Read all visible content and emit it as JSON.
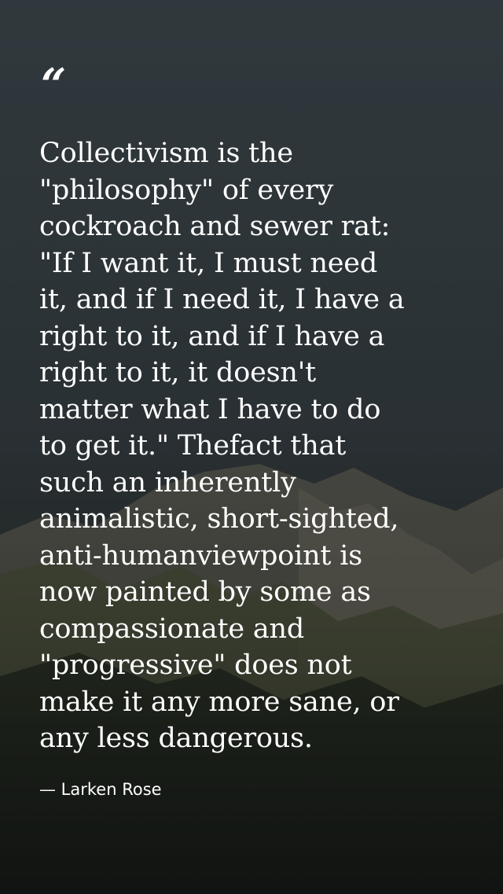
{
  "quote": {
    "mark": "“",
    "lines": [
      "Collectivism is the",
      "\"philosophy\" of every",
      "cockroach and sewer rat:",
      "\"If I want it, I must need",
      "it, and if I need it, I have a",
      "right to it, and if I have a",
      "right to it, it doesn't",
      "matter what I have to do",
      "to get it.\" Thefact that",
      "such an inherently",
      "animalistic, short-sighted,",
      "anti-humanviewpoint is",
      "now painted by some as",
      "compassionate and",
      "\"progressive\" does not",
      "make it any more sane, or",
      "any less dangerous."
    ],
    "attribution": "— Larken Rose"
  }
}
